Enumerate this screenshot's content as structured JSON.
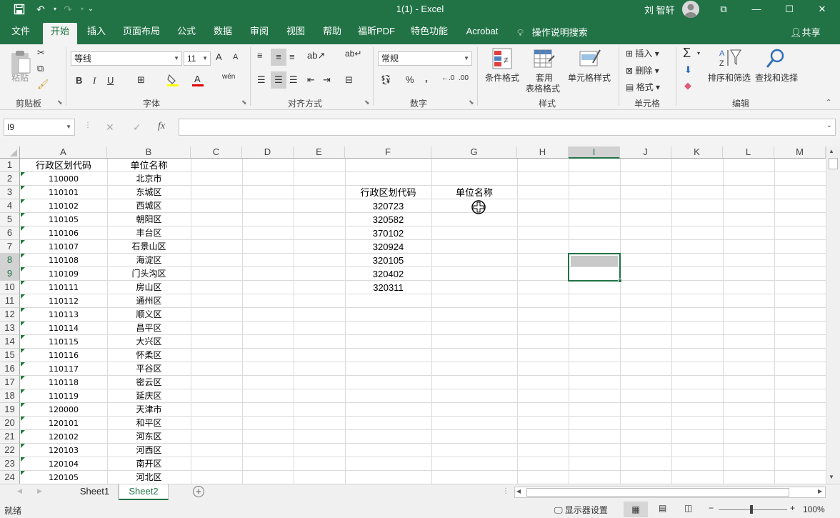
{
  "titlebar": {
    "title": "1(1)  -  Excel",
    "user": "刘 智轩",
    "buttons": {
      "ribbon_display": "⧉",
      "minimize": "—",
      "maximize": "☐",
      "close": "✕"
    }
  },
  "tabs": [
    "文件",
    "开始",
    "插入",
    "页面布局",
    "公式",
    "数据",
    "审阅",
    "视图",
    "帮助",
    "福昕PDF",
    "特色功能",
    "Acrobat"
  ],
  "active_tab": "开始",
  "tell_me": "操作说明搜索",
  "share": "共享",
  "ribbon": {
    "clipboard": {
      "paste": "粘贴",
      "label": "剪贴板"
    },
    "font": {
      "name": "等线",
      "size": "11",
      "label": "字体",
      "bold": "B",
      "italic": "I",
      "underline": "U",
      "grow": "A",
      "shrink": "A",
      "wen": "wén"
    },
    "alignment": {
      "label": "对齐方式"
    },
    "number": {
      "format": "常规",
      "label": "数字",
      "percent": "%",
      "comma": ","
    },
    "styles": {
      "conditional": "条件格式",
      "table_line1": "套用",
      "table_line2": "表格格式",
      "cell_styles": "单元格样式",
      "label": "样式"
    },
    "cells": {
      "insert": "插入",
      "delete": "删除",
      "format": "格式",
      "label": "单元格"
    },
    "editing": {
      "sort": "排序和筛选",
      "find": "查找和选择",
      "label": "编辑"
    }
  },
  "formula_bar": {
    "name_box": "I9",
    "cancel": "✕",
    "enter": "✓",
    "fx": "fx",
    "value": ""
  },
  "columns": [
    "A",
    "B",
    "C",
    "D",
    "E",
    "F",
    "G",
    "H",
    "I",
    "J",
    "K",
    "L",
    "M"
  ],
  "selected_column": "I",
  "rows": [
    "1",
    "2",
    "3",
    "4",
    "5",
    "6",
    "7",
    "8",
    "9",
    "10",
    "11",
    "12",
    "13",
    "14",
    "15",
    "16",
    "17",
    "18",
    "19",
    "20",
    "21",
    "22",
    "23",
    "24"
  ],
  "selected_rows": [
    "8",
    "9"
  ],
  "sheet": {
    "col_a_header": "行政区划代码",
    "col_b_header": "单位名称",
    "data_rows": [
      [
        "110000",
        "北京市"
      ],
      [
        "110101",
        "东城区"
      ],
      [
        "110102",
        "西城区"
      ],
      [
        "110105",
        "朝阳区"
      ],
      [
        "110106",
        "丰台区"
      ],
      [
        "110107",
        "石景山区"
      ],
      [
        "110108",
        "海淀区"
      ],
      [
        "110109",
        "门头沟区"
      ],
      [
        "110111",
        "房山区"
      ],
      [
        "110112",
        "通州区"
      ],
      [
        "110113",
        "顺义区"
      ],
      [
        "110114",
        "昌平区"
      ],
      [
        "110115",
        "大兴区"
      ],
      [
        "110116",
        "怀柔区"
      ],
      [
        "110117",
        "平谷区"
      ],
      [
        "110118",
        "密云区"
      ],
      [
        "110119",
        "延庆区"
      ],
      [
        "120000",
        "天津市"
      ],
      [
        "120101",
        "和平区"
      ],
      [
        "120102",
        "河东区"
      ],
      [
        "120103",
        "河西区"
      ],
      [
        "120104",
        "南开区"
      ],
      [
        "120105",
        "河北区"
      ]
    ],
    "lookup_header_f": "行政区划代码",
    "lookup_header_g": "单位名称",
    "lookup_codes": [
      "320723",
      "320582",
      "370102",
      "320924",
      "320105",
      "320402",
      "320311"
    ]
  },
  "sheet_tabs": [
    "Sheet1",
    "Sheet2"
  ],
  "active_sheet": "Sheet2",
  "status": {
    "ready": "就绪",
    "display_settings": "显示器设置",
    "zoom": "100%"
  },
  "colors": {
    "excel_green": "#217346",
    "selection_fill": "#c8c8c8"
  }
}
